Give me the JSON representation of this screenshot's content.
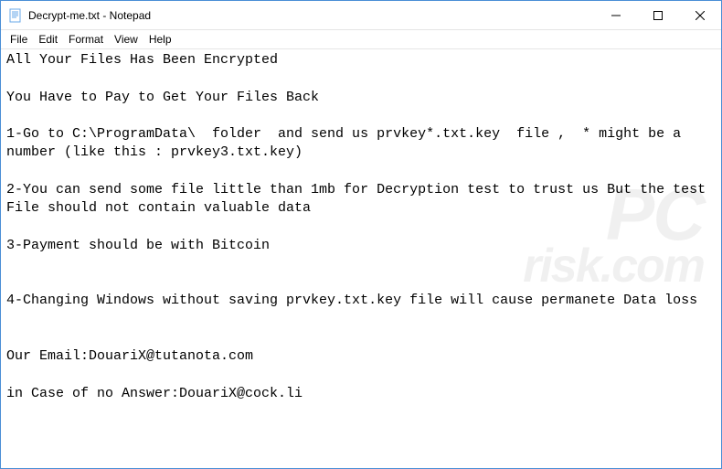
{
  "window": {
    "title": "Decrypt-me.txt - Notepad"
  },
  "menu": {
    "file": "File",
    "edit": "Edit",
    "format": "Format",
    "view": "View",
    "help": "Help"
  },
  "content": {
    "text": "All Your Files Has Been Encrypted\n\nYou Have to Pay to Get Your Files Back\n\n1-Go to C:\\ProgramData\\  folder  and send us prvkey*.txt.key  file ,  * might be a number (like this : prvkey3.txt.key)\n\n2-You can send some file little than 1mb for Decryption test to trust us But the test File should not contain valuable data\n\n3-Payment should be with Bitcoin\n\n\n4-Changing Windows without saving prvkey.txt.key file will cause permanete Data loss\n\n\nOur Email:DouariX@tutanota.com\n\nin Case of no Answer:DouariX@cock.li"
  },
  "watermark": {
    "line1": "PC",
    "line2": "risk.com"
  }
}
